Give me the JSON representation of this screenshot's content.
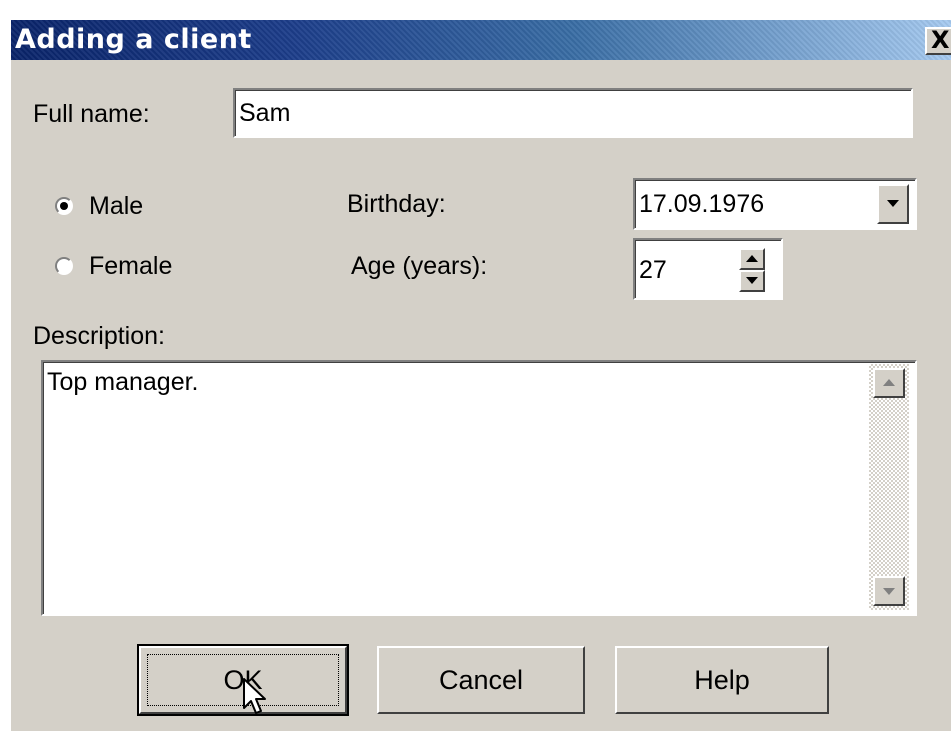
{
  "window": {
    "title": "Adding a client",
    "close_label": "X"
  },
  "form": {
    "full_name_label": "Full name:",
    "full_name_value": "Sam",
    "gender_options": [
      {
        "label": "Male",
        "selected": true
      },
      {
        "label": "Female",
        "selected": false
      }
    ],
    "birthday_label": "Birthday:",
    "birthday_value": "17.09.1976",
    "age_label": "Age (years):",
    "age_value": "27",
    "description_label": "Description:",
    "description_value": "Top manager."
  },
  "buttons": {
    "ok_label": "OK",
    "cancel_label": "Cancel",
    "help_label": "Help"
  },
  "icons": [
    "close-icon",
    "dropdown-arrow-icon",
    "spin-up-icon",
    "spin-down-icon",
    "scroll-up-icon",
    "scroll-down-icon",
    "mouse-cursor-icon"
  ]
}
